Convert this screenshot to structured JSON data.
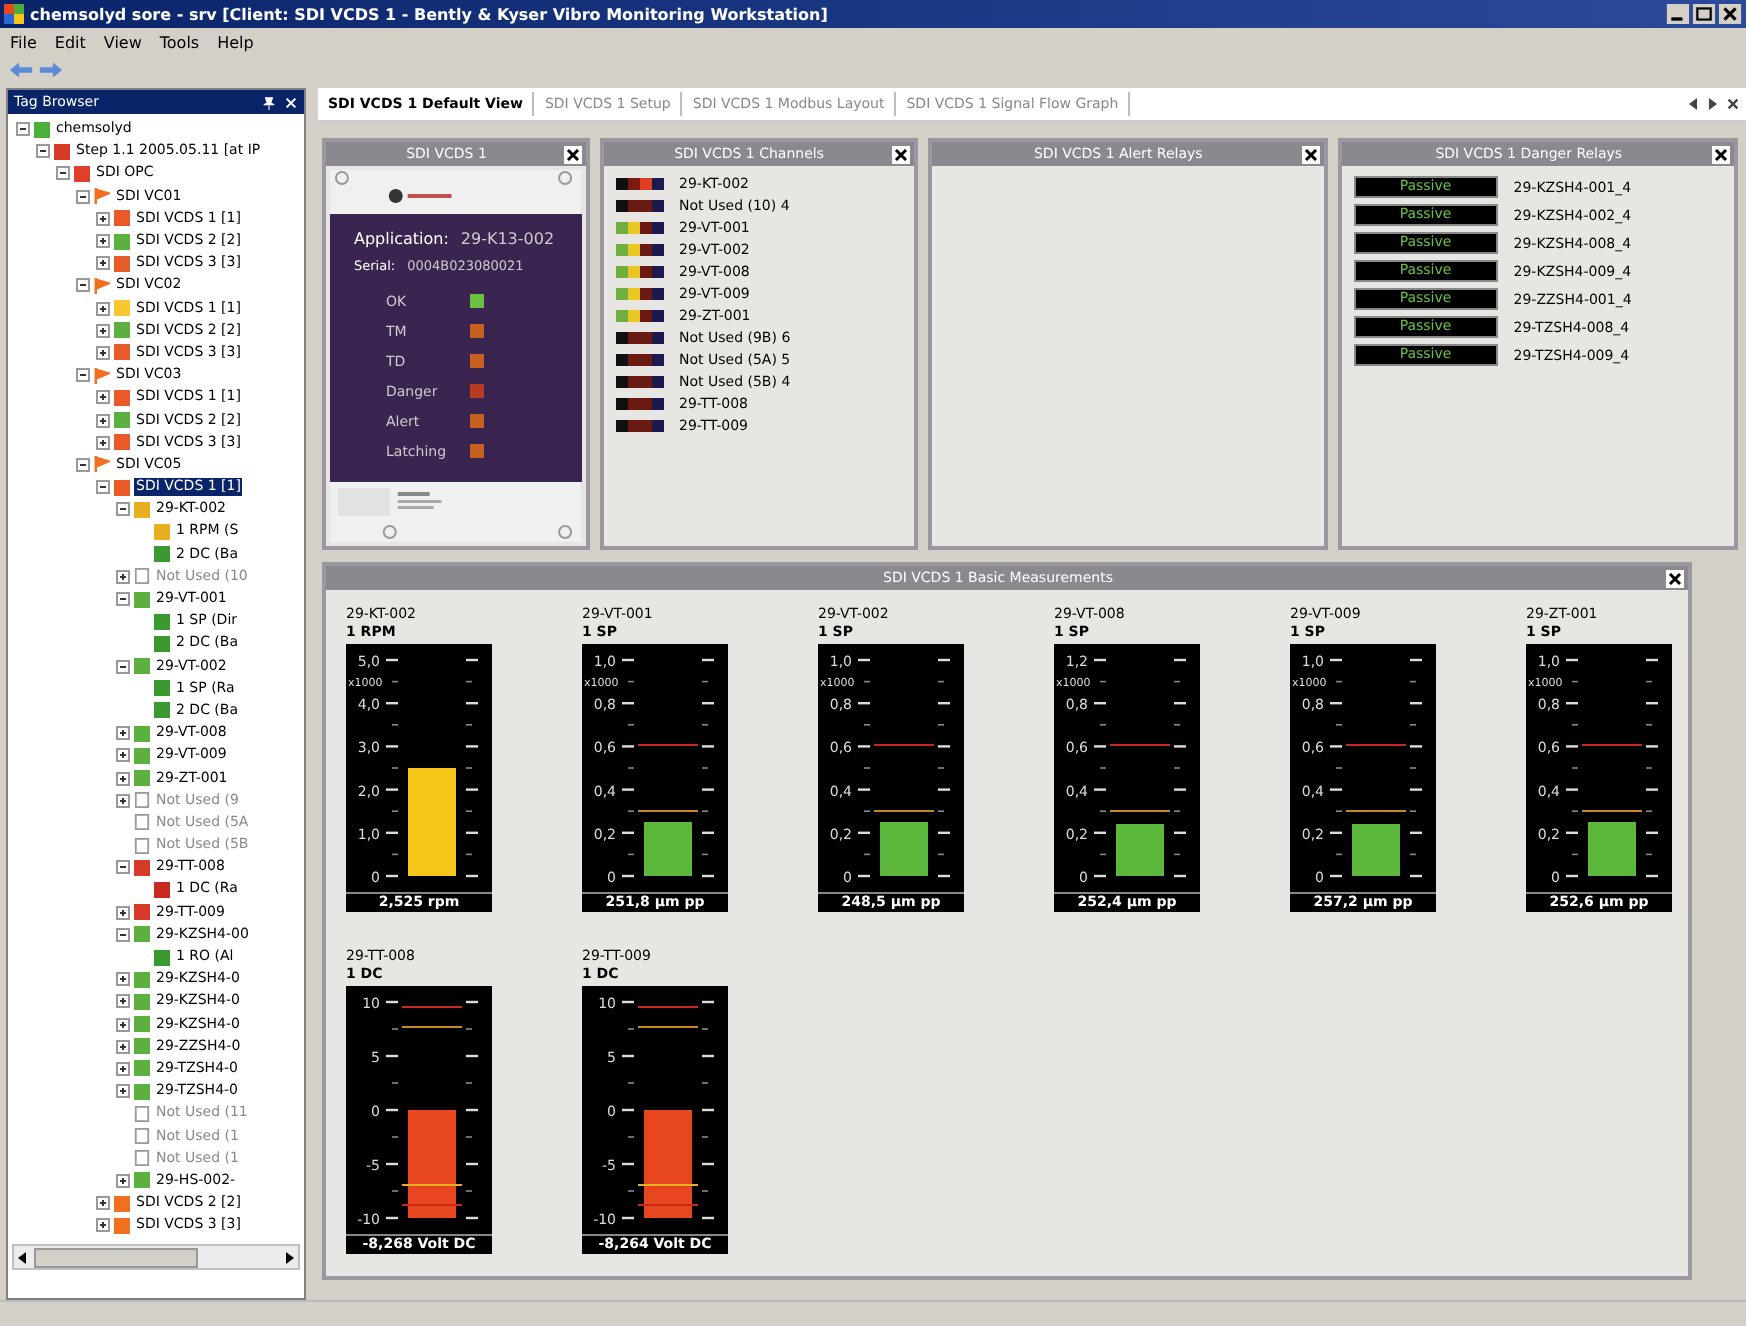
{
  "window": {
    "title": "chemsolyd sore - srv [Client: SDI VCDS 1 - Bently & Kyser Vibro Monitoring Workstation]"
  },
  "menu": [
    "File",
    "Edit",
    "View",
    "Tools",
    "Help"
  ],
  "tree_panel": {
    "title": "Tag Browser"
  },
  "tree": [
    {
      "label": "chemsolyd",
      "kind": "square",
      "color": "#4caf3a",
      "selected": false,
      "expanded": true,
      "children": [
        {
          "label": "Step 1.1 2005.05.11 [at IP",
          "kind": "square",
          "color": "#d83a2a",
          "selected": false,
          "expanded": true,
          "children": [
            {
              "label": "SDI OPC",
              "kind": "square",
              "color": "#e0402a",
              "selected": false,
              "expanded": true,
              "children": [
                {
                  "label": "SDI VC01",
                  "kind": "flag",
                  "color": "#f07020",
                  "selected": false,
                  "expanded": true,
                  "children": [
                    {
                      "label": "SDI VCDS 1 [1]",
                      "kind": "square",
                      "color": "#e85a28",
                      "selected": false,
                      "expanded": false
                    },
                    {
                      "label": "SDI VCDS 2 [2]",
                      "kind": "square",
                      "color": "#5cb040",
                      "selected": false,
                      "expanded": false
                    },
                    {
                      "label": "SDI VCDS 3 [3]",
                      "kind": "square",
                      "color": "#e85a28",
                      "selected": false,
                      "expanded": false
                    }
                  ]
                },
                {
                  "label": "SDI VC02",
                  "kind": "flag",
                  "color": "#f07020",
                  "selected": false,
                  "expanded": true,
                  "children": [
                    {
                      "label": "SDI VCDS 1 [1]",
                      "kind": "square",
                      "color": "#f5c830",
                      "selected": false,
                      "expanded": false
                    },
                    {
                      "label": "SDI VCDS 2 [2]",
                      "kind": "square",
                      "color": "#5cb040",
                      "selected": false,
                      "expanded": false
                    },
                    {
                      "label": "SDI VCDS 3 [3]",
                      "kind": "square",
                      "color": "#e85a28",
                      "selected": false,
                      "expanded": false
                    }
                  ]
                },
                {
                  "label": "SDI VC03",
                  "kind": "flag",
                  "color": "#f07020",
                  "selected": false,
                  "expanded": true,
                  "children": [
                    {
                      "label": "SDI VCDS 1 [1]",
                      "kind": "square",
                      "color": "#e85a28",
                      "selected": false,
                      "expanded": false
                    },
                    {
                      "label": "SDI VCDS 2 [2]",
                      "kind": "square",
                      "color": "#5cb040",
                      "selected": false,
                      "expanded": false
                    },
                    {
                      "label": "SDI VCDS 3 [3]",
                      "kind": "square",
                      "color": "#e85a28",
                      "selected": false,
                      "expanded": false
                    }
                  ]
                },
                {
                  "label": "SDI VC05",
                  "kind": "flag",
                  "color": "#f07020",
                  "selected": false,
                  "expanded": true,
                  "children": [
                    {
                      "label": "SDI VCDS 1 [1]",
                      "kind": "square",
                      "color": "#e85a28",
                      "selected": true,
                      "expanded": true,
                      "children": [
                        {
                          "label": "29-KT-002",
                          "kind": "square",
                          "color": "#e8b020",
                          "selected": false,
                          "expanded": true,
                          "children": [
                            {
                              "label": "1 RPM (S",
                              "kind": "square",
                              "color": "#e8b020",
                              "selected": false
                            },
                            {
                              "label": "2 DC (Ba",
                              "kind": "square",
                              "color": "#3a9a30",
                              "selected": false
                            }
                          ]
                        },
                        {
                          "label": "Not Used (10",
                          "kind": "blank",
                          "color": "#ffffff",
                          "selected": false,
                          "expanded": false
                        },
                        {
                          "label": "29-VT-001",
                          "kind": "square",
                          "color": "#5cb040",
                          "selected": false,
                          "expanded": true,
                          "children": [
                            {
                              "label": "1 SP (Dir",
                              "kind": "square",
                              "color": "#3a9a30",
                              "selected": false
                            },
                            {
                              "label": "2 DC (Ba",
                              "kind": "square",
                              "color": "#3a9a30",
                              "selected": false
                            }
                          ]
                        },
                        {
                          "label": "29-VT-002",
                          "kind": "square",
                          "color": "#5cb040",
                          "selected": false,
                          "expanded": true,
                          "children": [
                            {
                              "label": "1 SP (Ra",
                              "kind": "square",
                              "color": "#3a9a30",
                              "selected": false
                            },
                            {
                              "label": "2 DC (Ba",
                              "kind": "square",
                              "color": "#3a9a30",
                              "selected": false
                            }
                          ]
                        },
                        {
                          "label": "29-VT-008",
                          "kind": "square",
                          "color": "#5cb040",
                          "selected": false,
                          "expanded": false
                        },
                        {
                          "label": "29-VT-009",
                          "kind": "square",
                          "color": "#5cb040",
                          "selected": false,
                          "expanded": false
                        },
                        {
                          "label": "29-ZT-001",
                          "kind": "square",
                          "color": "#5cb040",
                          "selected": false,
                          "expanded": false
                        },
                        {
                          "label": "Not Used (9",
                          "kind": "blank",
                          "color": "#ffffff",
                          "selected": false,
                          "expanded": false
                        },
                        {
                          "label": "Not Used (5A",
                          "kind": "blank",
                          "color": "#ffffff",
                          "selected": false
                        },
                        {
                          "label": "Not Used (5B",
                          "kind": "blank",
                          "color": "#ffffff",
                          "selected": false
                        },
                        {
                          "label": "29-TT-008",
                          "kind": "square",
                          "color": "#d83a2a",
                          "selected": false,
                          "expanded": true,
                          "children": [
                            {
                              "label": "1 DC (Ra",
                              "kind": "square",
                              "color": "#c82a22",
                              "selected": false
                            }
                          ]
                        },
                        {
                          "label": "29-TT-009",
                          "kind": "square",
                          "color": "#d83a2a",
                          "selected": false,
                          "expanded": false
                        },
                        {
                          "label": "29-KZSH4-00",
                          "kind": "square",
                          "color": "#5cb040",
                          "selected": false,
                          "expanded": true,
                          "children": [
                            {
                              "label": "1 RO (Al",
                              "kind": "square",
                              "color": "#3a9a30",
                              "selected": false
                            }
                          ]
                        },
                        {
                          "label": "29-KZSH4-0",
                          "kind": "square",
                          "color": "#5cb040",
                          "selected": false,
                          "expanded": false
                        },
                        {
                          "label": "29-KZSH4-0",
                          "kind": "square",
                          "color": "#5cb040",
                          "selected": false,
                          "expanded": false
                        },
                        {
                          "label": "29-KZSH4-0",
                          "kind": "square",
                          "color": "#5cb040",
                          "selected": false,
                          "expanded": false
                        },
                        {
                          "label": "29-ZZSH4-0",
                          "kind": "square",
                          "color": "#5cb040",
                          "selected": false,
                          "expanded": false
                        },
                        {
                          "label": "29-TZSH4-0",
                          "kind": "square",
                          "color": "#5cb040",
                          "selected": false,
                          "expanded": false
                        },
                        {
                          "label": "29-TZSH4-0",
                          "kind": "square",
                          "color": "#5cb040",
                          "selected": false,
                          "expanded": false
                        },
                        {
                          "label": "Not Used (11",
                          "kind": "blank",
                          "color": "#ffffff",
                          "selected": false
                        },
                        {
                          "label": "Not Used (1",
                          "kind": "blank",
                          "color": "#ffffff",
                          "selected": false
                        },
                        {
                          "label": "Not Used (1",
                          "kind": "blank",
                          "color": "#ffffff",
                          "selected": false
                        },
                        {
                          "label": "29-HS-002-",
                          "kind": "square",
                          "color": "#5cb040",
                          "selected": false,
                          "expanded": false
                        }
                      ]
                    },
                    {
                      "label": "SDI VCDS 2 [2]",
                      "kind": "square",
                      "color": "#f07020",
                      "selected": false,
                      "expanded": false
                    },
                    {
                      "label": "SDI VCDS 3 [3]",
                      "kind": "square",
                      "color": "#f07020",
                      "selected": false,
                      "expanded": false
                    }
                  ]
                }
              ]
            }
          ]
        }
      ]
    }
  ],
  "tabs": [
    {
      "label": "SDI VCDS 1 Default View",
      "selected": true
    },
    {
      "label": "SDI VCDS 1 Setup",
      "selected": false
    },
    {
      "label": "SDI VCDS 1 Modbus Layout",
      "selected": false
    },
    {
      "label": "SDI VCDS 1 Signal Flow Graph",
      "selected": false
    }
  ],
  "device_panel": {
    "title": "SDI VCDS 1",
    "application_label": "Application:",
    "application": "29-K13-002",
    "serial_label": "Serial:",
    "serial": "0004B023080021",
    "leds": [
      {
        "label": "OK",
        "color": "#6cc040"
      },
      {
        "label": "TM",
        "color": "#c86020"
      },
      {
        "label": "TD",
        "color": "#c86020"
      },
      {
        "label": "Danger",
        "color": "#b83a20"
      },
      {
        "label": "Alert",
        "color": "#c86020"
      },
      {
        "label": "Latching",
        "color": "#c86020"
      }
    ]
  },
  "channels_panel": {
    "title": "SDI VCDS 1 Channels",
    "channels": [
      {
        "label": "29-KT-002",
        "segments": [
          {
            "color": "#101010"
          },
          {
            "color": "#7a1a10"
          },
          {
            "color": "#e04020"
          },
          {
            "color": "#1a1a50"
          }
        ]
      },
      {
        "label": "Not Used (10) 4",
        "segments": [
          {
            "color": "#101010"
          },
          {
            "color": "#6a1a10"
          },
          {
            "color": "#6a1a10"
          },
          {
            "color": "#1a1a50"
          }
        ]
      },
      {
        "label": "29-VT-001",
        "segments": [
          {
            "color": "#70b040"
          },
          {
            "color": "#e8c820"
          },
          {
            "color": "#6a1a10"
          },
          {
            "color": "#1a1a50"
          }
        ]
      },
      {
        "label": "29-VT-002",
        "segments": [
          {
            "color": "#70b040"
          },
          {
            "color": "#e8c820"
          },
          {
            "color": "#6a1a10"
          },
          {
            "color": "#1a1a50"
          }
        ]
      },
      {
        "label": "29-VT-008",
        "segments": [
          {
            "color": "#70b040"
          },
          {
            "color": "#e8c820"
          },
          {
            "color": "#6a1a10"
          },
          {
            "color": "#1a1a50"
          }
        ]
      },
      {
        "label": "29-VT-009",
        "segments": [
          {
            "color": "#70b040"
          },
          {
            "color": "#e8c820"
          },
          {
            "color": "#6a1a10"
          },
          {
            "color": "#1a1a50"
          }
        ]
      },
      {
        "label": "29-ZT-001",
        "segments": [
          {
            "color": "#70b040"
          },
          {
            "color": "#e8c820"
          },
          {
            "color": "#6a1a10"
          },
          {
            "color": "#1a1a50"
          }
        ]
      },
      {
        "label": "Not Used (9B) 6",
        "segments": [
          {
            "color": "#101010"
          },
          {
            "color": "#6a1a10"
          },
          {
            "color": "#6a1a10"
          },
          {
            "color": "#1a1a50"
          }
        ]
      },
      {
        "label": "Not Used (5A) 5",
        "segments": [
          {
            "color": "#101010"
          },
          {
            "color": "#6a1a10"
          },
          {
            "color": "#6a1a10"
          },
          {
            "color": "#1a1a50"
          }
        ]
      },
      {
        "label": "Not Used (5B) 4",
        "segments": [
          {
            "color": "#101010"
          },
          {
            "color": "#6a1a10"
          },
          {
            "color": "#6a1a10"
          },
          {
            "color": "#1a1a50"
          }
        ]
      },
      {
        "label": "29-TT-008",
        "segments": [
          {
            "color": "#101010"
          },
          {
            "color": "#6a1a10"
          },
          {
            "color": "#6a1a10"
          },
          {
            "color": "#1a1a50"
          }
        ]
      },
      {
        "label": "29-TT-009",
        "segments": [
          {
            "color": "#101010"
          },
          {
            "color": "#6a1a10"
          },
          {
            "color": "#6a1a10"
          },
          {
            "color": "#1a1a50"
          }
        ]
      }
    ]
  },
  "alert_panel": {
    "title": "SDI VCDS 1 Alert Relays"
  },
  "danger_panel": {
    "title": "SDI VCDS 1 Danger Relays",
    "relays": [
      {
        "status": "Passive",
        "label": "29-KZSH4-001_4"
      },
      {
        "status": "Passive",
        "label": "29-KZSH4-002_4"
      },
      {
        "status": "Passive",
        "label": "29-KZSH4-008_4"
      },
      {
        "status": "Passive",
        "label": "29-KZSH4-009_4"
      },
      {
        "status": "Passive",
        "label": "29-ZZSH4-001_4"
      },
      {
        "status": "Passive",
        "label": "29-TZSH4-008_4"
      },
      {
        "status": "Passive",
        "label": "29-TZSH4-009_4"
      }
    ]
  },
  "measurements_panel": {
    "title": "SDI VCDS 1 Basic Measurements",
    "meters": [
      {
        "tag": "29-KT-002",
        "channel": "1 RPM",
        "kind": "rpm",
        "scale": [
          "5,0",
          "4,0",
          "3,0",
          "2,0",
          "1,0",
          "0"
        ],
        "unit": "x1000",
        "level": 0.5,
        "color": "#f5c518",
        "reading": "2,525 rpm"
      },
      {
        "tag": "29-VT-001",
        "channel": "1 SP",
        "kind": "ac",
        "scale": [
          "1,0",
          "0,8",
          "0,6",
          "0,4",
          "0,2",
          "0"
        ],
        "unit": "x1000",
        "level": 0.25,
        "color": "#5cb83a",
        "reading": "251,8 µm pp"
      },
      {
        "tag": "29-VT-002",
        "channel": "1 SP",
        "kind": "ac",
        "scale": [
          "1,0",
          "0,8",
          "0,6",
          "0,4",
          "0,2",
          "0"
        ],
        "unit": "x1000",
        "level": 0.25,
        "color": "#5cb83a",
        "reading": "248,5 µm pp"
      },
      {
        "tag": "29-VT-008",
        "channel": "1 SP",
        "kind": "ac",
        "scale": [
          "1,2",
          "0,8",
          "0,6",
          "0,4",
          "0,2",
          "0"
        ],
        "unit": "x1000",
        "level": 0.24,
        "color": "#5cb83a",
        "reading": "252,4 µm pp"
      },
      {
        "tag": "29-VT-009",
        "channel": "1 SP",
        "kind": "ac",
        "scale": [
          "1,0",
          "0,8",
          "0,6",
          "0,4",
          "0,2",
          "0"
        ],
        "unit": "x1000",
        "level": 0.24,
        "color": "#5cb83a",
        "reading": "257,2 µm pp"
      },
      {
        "tag": "29-ZT-001",
        "channel": "1 SP",
        "kind": "ac",
        "scale": [
          "1,0",
          "0,8",
          "0,6",
          "0,4",
          "0,2",
          "0"
        ],
        "unit": "x1000",
        "level": 0.25,
        "color": "#5cb83a",
        "reading": "252,6 µm pp"
      },
      {
        "tag": "29-TT-008",
        "channel": "1 DC",
        "kind": "dc",
        "scale": [
          "10",
          "5",
          "0",
          "-5",
          "-10"
        ],
        "level": 0.5,
        "color": "#e8461e",
        "reading": "-8,268 Volt DC"
      },
      {
        "tag": "29-TT-009",
        "channel": "1 DC",
        "kind": "dc",
        "scale": [
          "10",
          "5",
          "0",
          "-5",
          "-10"
        ],
        "level": 0.5,
        "color": "#e8461e",
        "reading": "-8,264 Volt DC"
      }
    ]
  }
}
